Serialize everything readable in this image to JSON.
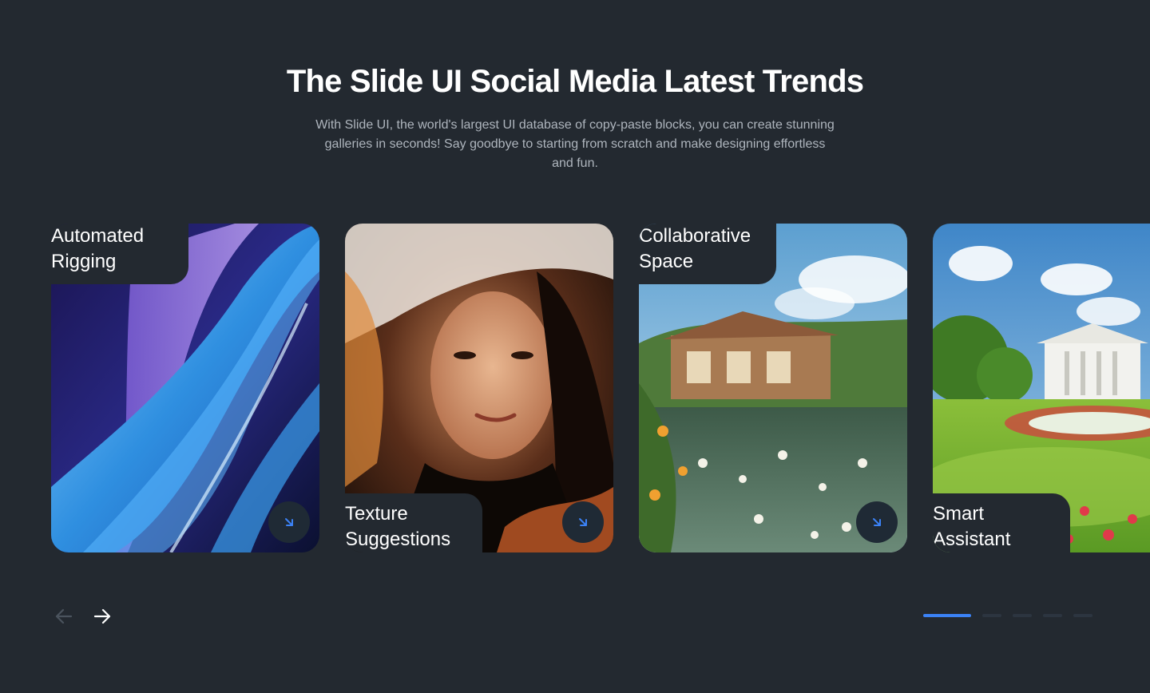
{
  "header": {
    "title": "The Slide UI Social Media Latest Trends",
    "description": "With Slide UI, the world's largest UI database of copy-paste blocks, you can create stunning galleries in seconds! Say goodbye to starting from scratch and make designing effortless and fun."
  },
  "cards": [
    {
      "title_line1": "Automated",
      "title_line2": "Rigging",
      "button_icon": "arrow-down-right-icon"
    },
    {
      "title_line1": "Texture",
      "title_line2": "Suggestions",
      "button_icon": "arrow-down-right-icon"
    },
    {
      "title_line1": "Collaborative",
      "title_line2": "Space",
      "button_icon": "arrow-down-right-icon"
    },
    {
      "title_line1": "Smart",
      "title_line2": "Assistant",
      "button_icon": "arrow-down-right-icon"
    }
  ],
  "navigation": {
    "prev_icon": "arrow-left-icon",
    "next_icon": "arrow-right-icon",
    "pagination": {
      "total": 5,
      "active": 1
    }
  },
  "colors": {
    "background": "#232930",
    "accent": "#3b82f6",
    "muted_text": "#aeb5bd"
  }
}
